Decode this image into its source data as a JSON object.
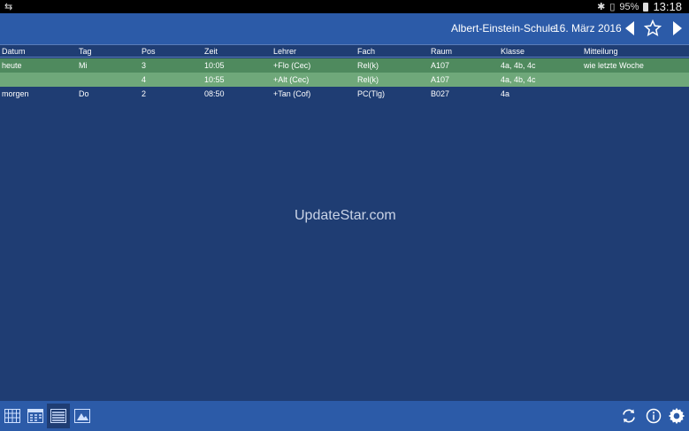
{
  "statusbar": {
    "battery": "95%",
    "time": "13:18"
  },
  "header": {
    "school": "Albert-Einstein-Schule",
    "date": "16. März 2016"
  },
  "table": {
    "columns": [
      "Datum",
      "Tag",
      "Pos",
      "Zeit",
      "Lehrer",
      "Fach",
      "Raum",
      "Klasse",
      "Mitteilung"
    ],
    "rows": [
      [
        "heute",
        "Mi",
        "3",
        "10:05",
        "+Flo (Cec)",
        "Rel(k)",
        "A107",
        "4a, 4b, 4c",
        "wie letzte Woche"
      ],
      [
        "",
        "",
        "4",
        "10:55",
        "+Alt (Cec)",
        "Rel(k)",
        "A107",
        "4a, 4b, 4c",
        ""
      ],
      [
        "morgen",
        "Do",
        "2",
        "08:50",
        "+Tan (Cof)",
        "PC(Tlg)",
        "B027",
        "4a",
        ""
      ]
    ]
  },
  "watermark": "UpdateStar.com",
  "icons": {
    "prev": "chevron-left-icon",
    "favorite": "star-icon",
    "next": "chevron-right-icon",
    "refresh": "refresh-icon",
    "info": "info-icon",
    "settings": "gear-icon"
  }
}
